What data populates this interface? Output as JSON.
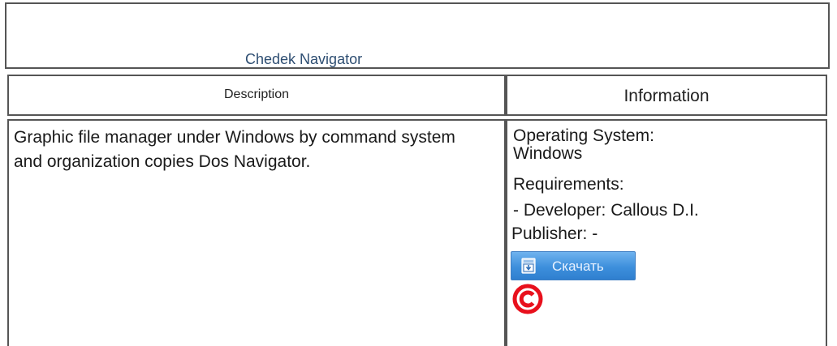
{
  "header": {
    "title": "Chedek Navigator"
  },
  "table": {
    "description_header": "Description",
    "information_header": "Information",
    "description_text": "Graphic file manager under Windows by command system and organization copies Dos Navigator.",
    "info": {
      "os_label": "Operating System:",
      "os_value": "Windows",
      "requirements_label": "Requirements:",
      "developer_line": "- Developer: Callous D.I.",
      "publisher_line": "Publisher: -"
    },
    "download_button_label": "Скачать",
    "download_icon": "download-icon",
    "copyright_icon": "copyright-icon"
  },
  "colors": {
    "title_text": "#2e4e72",
    "button_blue": "#3d8fdc",
    "copyright_red": "#e8101c",
    "border": "#555555"
  }
}
